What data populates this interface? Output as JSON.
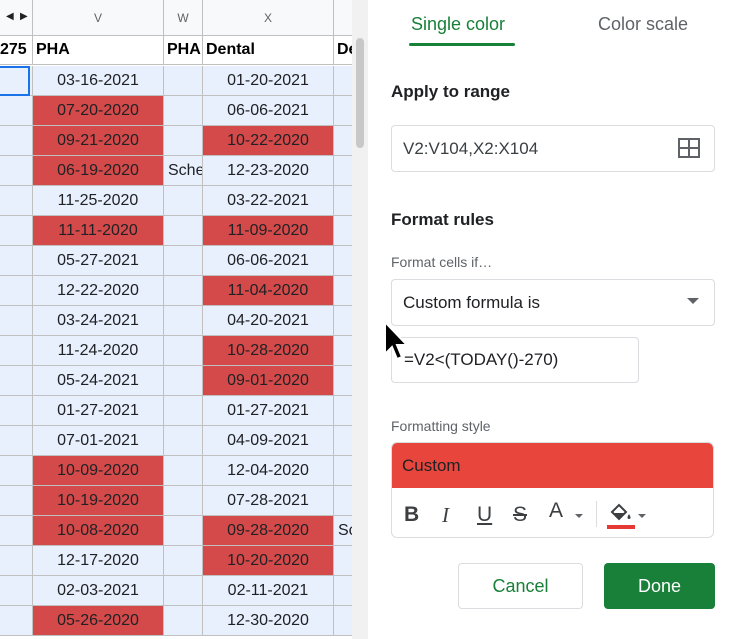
{
  "sheet": {
    "column_letters": [
      "V",
      "W",
      "X"
    ],
    "headers": {
      "partial_left": "275",
      "v": "PHA",
      "w": "PHA",
      "x": "Dental",
      "partial_right": "De"
    },
    "rows": [
      {
        "v": "03-16-2021",
        "v_red": false,
        "w": "",
        "x": "01-20-2021",
        "x_red": false,
        "y": ""
      },
      {
        "v": "07-20-2020",
        "v_red": true,
        "w": "",
        "x": "06-06-2021",
        "x_red": false,
        "y": ""
      },
      {
        "v": "09-21-2020",
        "v_red": true,
        "w": "",
        "x": "10-22-2020",
        "x_red": true,
        "y": ""
      },
      {
        "v": "06-19-2020",
        "v_red": true,
        "w": "Sche",
        "x": "12-23-2020",
        "x_red": false,
        "y": ""
      },
      {
        "v": "11-25-2020",
        "v_red": false,
        "w": "",
        "x": "03-22-2021",
        "x_red": false,
        "y": ""
      },
      {
        "v": "11-11-2020",
        "v_red": true,
        "w": "",
        "x": "11-09-2020",
        "x_red": true,
        "y": ""
      },
      {
        "v": "05-27-2021",
        "v_red": false,
        "w": "",
        "x": "06-06-2021",
        "x_red": false,
        "y": ""
      },
      {
        "v": "12-22-2020",
        "v_red": false,
        "w": "",
        "x": "11-04-2020",
        "x_red": true,
        "y": ""
      },
      {
        "v": "03-24-2021",
        "v_red": false,
        "w": "",
        "x": "04-20-2021",
        "x_red": false,
        "y": ""
      },
      {
        "v": "11-24-2020",
        "v_red": false,
        "w": "",
        "x": "10-28-2020",
        "x_red": true,
        "y": ""
      },
      {
        "v": "05-24-2021",
        "v_red": false,
        "w": "",
        "x": "09-01-2020",
        "x_red": true,
        "y": ""
      },
      {
        "v": "01-27-2021",
        "v_red": false,
        "w": "",
        "x": "01-27-2021",
        "x_red": false,
        "y": ""
      },
      {
        "v": "07-01-2021",
        "v_red": false,
        "w": "",
        "x": "04-09-2021",
        "x_red": false,
        "y": ""
      },
      {
        "v": "10-09-2020",
        "v_red": true,
        "w": "",
        "x": "12-04-2020",
        "x_red": false,
        "y": ""
      },
      {
        "v": "10-19-2020",
        "v_red": true,
        "w": "",
        "x": "07-28-2021",
        "x_red": false,
        "y": ""
      },
      {
        "v": "10-08-2020",
        "v_red": true,
        "w": "",
        "x": "09-28-2020",
        "x_red": true,
        "y": "Sc"
      },
      {
        "v": "12-17-2020",
        "v_red": false,
        "w": "",
        "x": "10-20-2020",
        "x_red": true,
        "y": ""
      },
      {
        "v": "02-03-2021",
        "v_red": false,
        "w": "",
        "x": "02-11-2021",
        "x_red": false,
        "y": ""
      },
      {
        "v": "05-26-2020",
        "v_red": true,
        "w": "",
        "x": "12-30-2020",
        "x_red": false,
        "y": ""
      }
    ],
    "highlight_color": "#d44a4a"
  },
  "panel": {
    "tabs": {
      "single": "Single color",
      "scale": "Color scale"
    },
    "apply_to_range_label": "Apply to range",
    "range_value": "V2:V104,X2:X104",
    "format_rules_label": "Format rules",
    "format_cells_if_label": "Format cells if…",
    "condition_value": "Custom formula is",
    "formula_value": "=V2<(TODAY()-270)",
    "formatting_style_label": "Formatting style",
    "style_preview_text": "Custom",
    "style_color": "#e8453c",
    "toolbar": {
      "bold": "B",
      "italic": "I",
      "underline": "U",
      "strike": "S",
      "text_color": "A"
    },
    "cancel_label": "Cancel",
    "done_label": "Done",
    "accent_color": "#188038"
  }
}
